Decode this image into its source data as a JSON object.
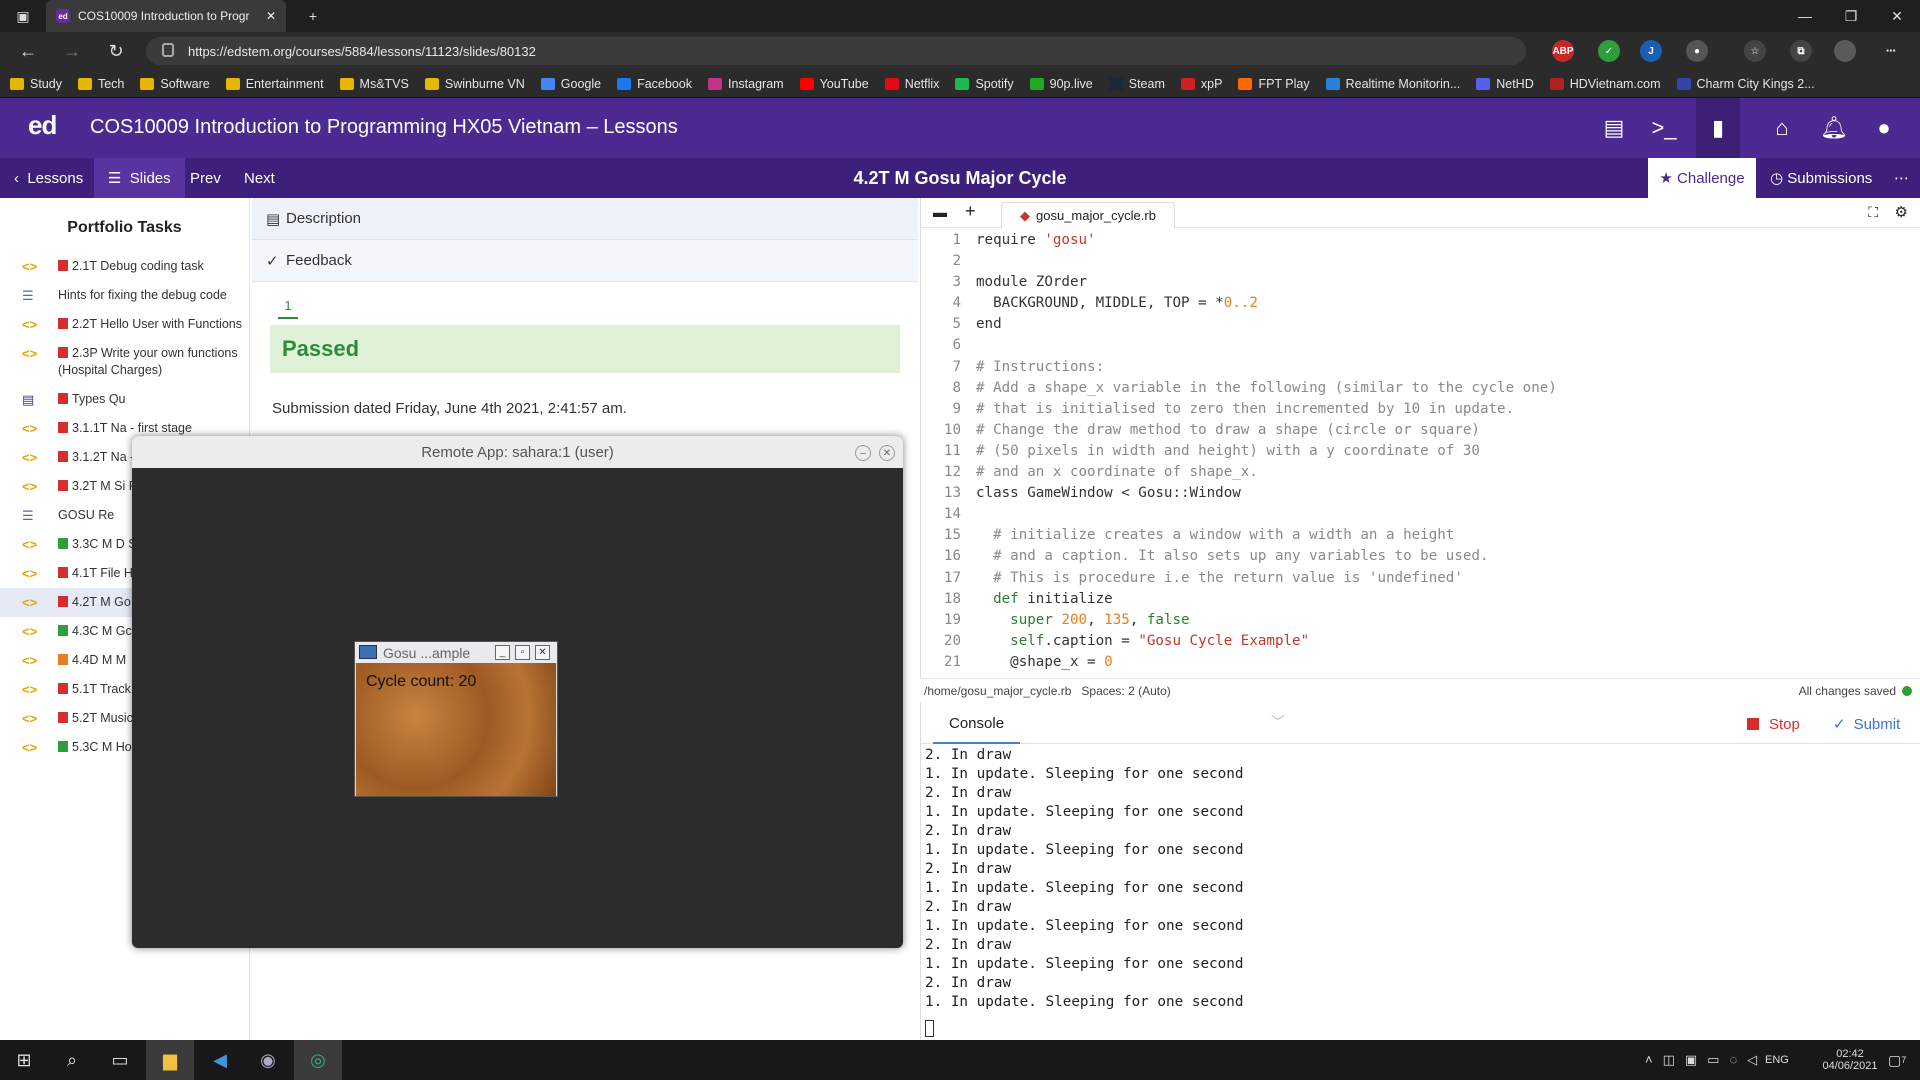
{
  "browser": {
    "tab_title": "COS10009 Introduction to Progr",
    "url": "https://edstem.org/courses/5884/lessons/11123/slides/80132",
    "bookmarks": [
      "Study",
      "Tech",
      "Software",
      "Entertainment",
      "Ms&TVS",
      "Swinburne VN",
      "Google",
      "Facebook",
      "Instagram",
      "YouTube",
      "Netflix",
      "Spotify",
      "90p.live",
      "Steam",
      "xpP",
      "FPT Play",
      "Realtime Monitorin...",
      "NetHD",
      "HDVietnam.com",
      "Charm City Kings 2..."
    ],
    "bookmark_colors": [
      "#e5b700",
      "#e5b700",
      "#e5b700",
      "#e5b700",
      "#e5b700",
      "#e5b700",
      "#4285f4",
      "#1877f2",
      "#c13584",
      "#ff0000",
      "#e50914",
      "#1db954",
      "#22aa22",
      "#1b2838",
      "#d01f1f",
      "#ff6a00",
      "#2a80d8",
      "#5561e8",
      "#b22222",
      "#3344aa"
    ]
  },
  "ed": {
    "logo": "ed",
    "course": "COS10009 Introduction to Programming HX05 Vietnam – Lessons",
    "lessons": "Lessons",
    "slides": "Slides",
    "prev": "Prev",
    "next": "Next",
    "slide_title": "4.2T M  Gosu Major Cycle",
    "challenge": "Challenge",
    "submissions": "Submissions"
  },
  "sidebar": {
    "title": "Portfolio Tasks",
    "items": [
      {
        "label": "2.1T  Debug coding task",
        "icon": "code",
        "sq": "#d32f2f"
      },
      {
        "label": "Hints for fixing the debug code",
        "icon": "doc",
        "sq": ""
      },
      {
        "label": "2.2T  Hello User with Functions",
        "icon": "code",
        "sq": "#d32f2f"
      },
      {
        "label": "2.3P  Write your own functions (Hospital Charges)",
        "icon": "code",
        "sq": "#d32f2f"
      },
      {
        "label": "Types Qu",
        "icon": "quiz",
        "sq": "#d32f2f"
      },
      {
        "label": "3.1.1T  Na - first stage",
        "icon": "code",
        "sq": "#d32f2f"
      },
      {
        "label": "3.1.2T  Na - second stag",
        "icon": "code",
        "sq": "#d32f2f"
      },
      {
        "label": "3.2T M  Si Program",
        "icon": "code",
        "sq": "#d32f2f"
      },
      {
        "label": "GOSU Re",
        "icon": "doc",
        "sq": ""
      },
      {
        "label": "3.3C M  D Shapes using",
        "icon": "code",
        "sq": "#2e9e3a"
      },
      {
        "label": "4.1T  File H",
        "icon": "code",
        "sq": "#d32f2f"
      },
      {
        "label": "4.2T M  Go Cycle",
        "icon": "code",
        "sq": "#d32f2f"
      },
      {
        "label": "4.3C M  Gc Moving",
        "icon": "code",
        "sq": "#2e9e3a"
      },
      {
        "label": "4.4D M  M",
        "icon": "code",
        "sq": "#e67e22"
      },
      {
        "label": "5.1T  Track Handling",
        "icon": "code",
        "sq": "#d32f2f"
      },
      {
        "label": "5.2T  Music Records",
        "icon": "code",
        "sq": "#d32f2f"
      },
      {
        "label": "5.3C M  Hover Button",
        "icon": "code",
        "sq": "#2e9e3a"
      }
    ]
  },
  "desc": {
    "description": "Description",
    "feedback": "Feedback",
    "tab": "1",
    "passed": "Passed",
    "submission": "Submission dated Friday, June 4th 2021, 2:41:57 am."
  },
  "editor": {
    "filename": "gosu_major_cycle.rb",
    "path": "/home/gosu_major_cycle.rb",
    "spaces": "Spaces: 2 (Auto)",
    "saved": "All changes saved"
  },
  "console": {
    "tab": "Console",
    "stop": "Stop",
    "submit": "Submit",
    "lines": [
      "2. In draw",
      "1. In update. Sleeping for one second",
      "2. In draw",
      "1. In update. Sleeping for one second",
      "2. In draw",
      "1. In update. Sleeping for one second",
      "2. In draw",
      "1. In update. Sleeping for one second",
      "2. In draw",
      "1. In update. Sleeping for one second",
      "2. In draw",
      "1. In update. Sleeping for one second",
      "2. In draw",
      "1. In update. Sleeping for one second"
    ]
  },
  "remote": {
    "title": "Remote App: sahara:1 (user)",
    "gosu_title": "Gosu ...ample",
    "cycle": "Cycle count: 20"
  },
  "taskbar": {
    "lang": "ENG",
    "time": "02:42",
    "date": "04/06/2021",
    "notif": "7"
  }
}
